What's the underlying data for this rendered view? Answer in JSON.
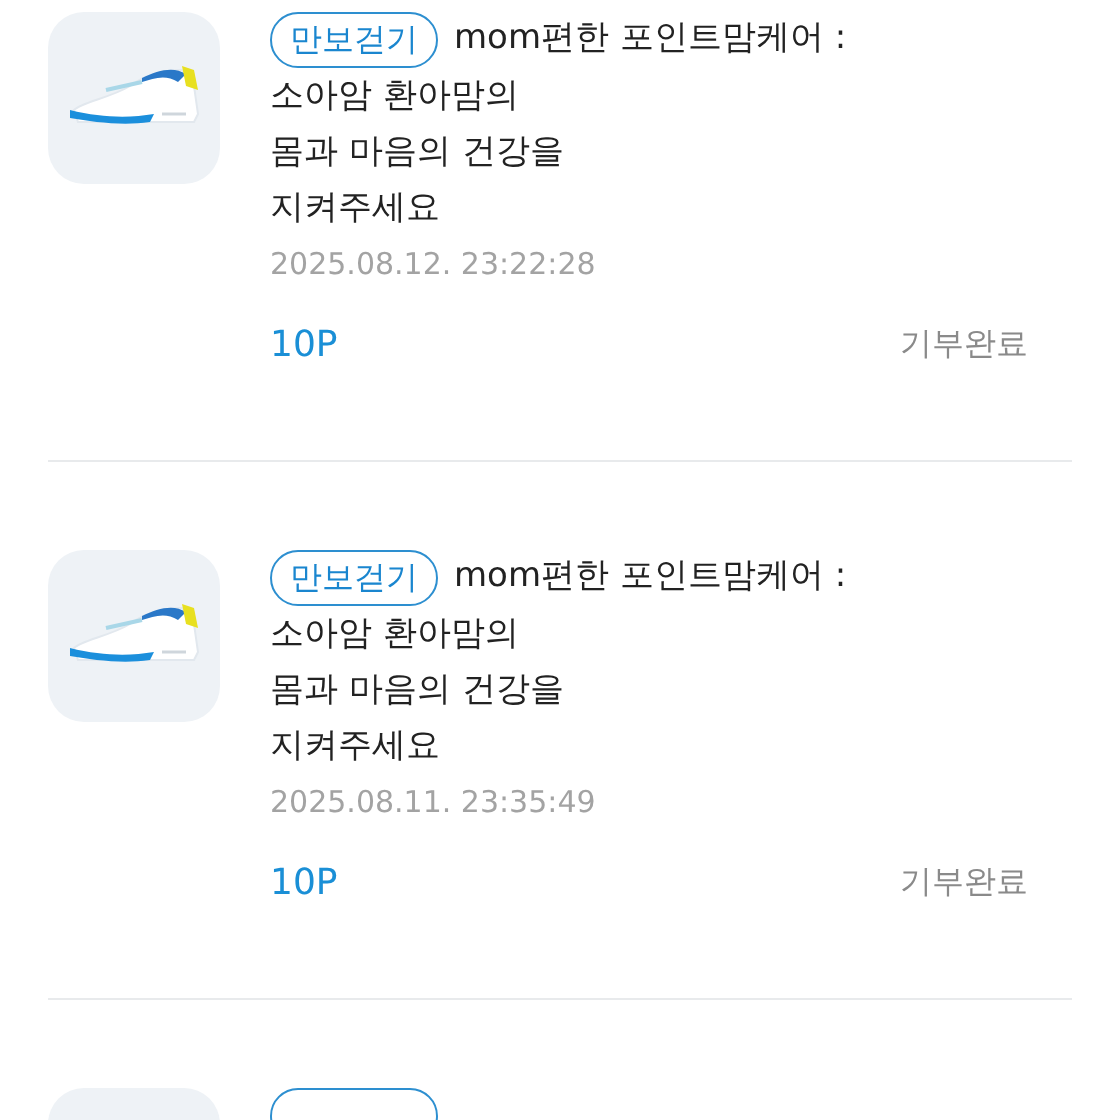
{
  "items": [
    {
      "tag": "만보걷기",
      "title": "mom편한 포인트맘케어 :",
      "lines": [
        "소아암 환아맘의",
        "몸과 마음의 건강을",
        "지켜주세요"
      ],
      "date": "2025.08.12. 23:22:28",
      "points": "10P",
      "status": "기부완료"
    },
    {
      "tag": "만보걷기",
      "title": "mom편한 포인트맘케어 :",
      "lines": [
        "소아암 환아맘의",
        "몸과 마음의 건강을",
        "지켜주세요"
      ],
      "date": "2025.08.11. 23:35:49",
      "points": "10P",
      "status": "기부완료"
    },
    {
      "kind": "partial"
    }
  ]
}
